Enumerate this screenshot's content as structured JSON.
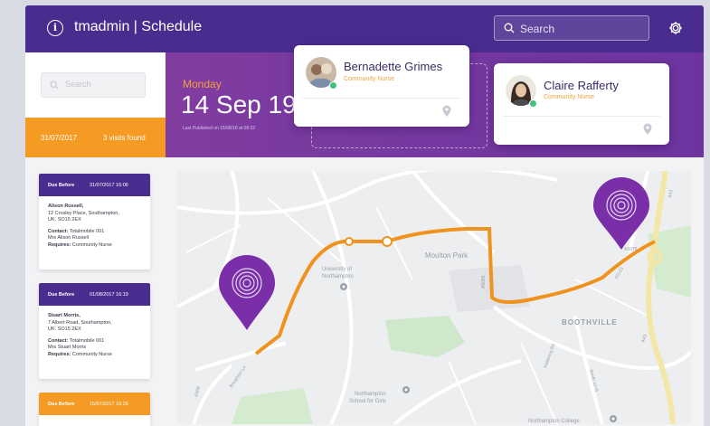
{
  "header": {
    "app_title": "tmadmin | Schedule",
    "search_placeholder": "Search",
    "info_icon": "info-icon",
    "settings_icon": "gear-icon"
  },
  "sidebar": {
    "search_placeholder": "Search",
    "date": "31/07/2017",
    "visits_found": "3 visits found"
  },
  "schedule": {
    "day": "Monday",
    "date": "14 Sep 19",
    "published": "Last Published on 15/08/18 at 08:32"
  },
  "staff": [
    {
      "name": "Bernadette Grimes",
      "role": "Community Nurse",
      "status_color": "#3ec27a"
    },
    {
      "name": "Claire Rafferty",
      "role": "Community Nurse",
      "status_color": "#3ec27a"
    }
  ],
  "visits": [
    {
      "due_label": "Due Before",
      "due": "31/07/2017 16:06",
      "header_color": "#4a2c8f",
      "name": "Alison Russell,",
      "address1": "12 Crosley Place, Southampton,",
      "address2": "UK. SO15 2EX",
      "contact_label": "Contact:",
      "contact": "Totalmobile 001",
      "contact2": "Mrs Alison Russell",
      "requires_label": "Requires:",
      "requires": "Community Nurse"
    },
    {
      "due_label": "Due Before",
      "due": "01/08/2017 16:19",
      "header_color": "#4a2c8f",
      "name": "Stuart Morris,",
      "address1": "7 Albert Road, Southampton,",
      "address2": "UK. SO15 2EX",
      "contact_label": "Contact:",
      "contact": "Totalmobile 001",
      "contact2": "Mrs Stuart Morris",
      "requires_label": "Requires:",
      "requires": "Community Nurse"
    },
    {
      "due_label": "Due Before",
      "due": "15/07/2017 16:26",
      "header_color": "#f59a23"
    }
  ],
  "map": {
    "labels": {
      "moulton_park": "Moulton Park",
      "university": "University of",
      "university2": "Northampton",
      "boothville": "BOOTHVILLE",
      "school": "Northampton",
      "school2": "School for Girls",
      "college": "Northampton College",
      "a43": "A43",
      "a5076": "A5076",
      "a508": "A508",
      "a43b": "A43",
      "a5123": "A5123",
      "kettering": "Kettering Rd",
      "boughton": "Boughton Ln",
      "booth": "Booth Ln N",
      "tollgate": "A5095"
    },
    "route_color": "#f0921e",
    "pin_color": "#7a2fa8"
  }
}
